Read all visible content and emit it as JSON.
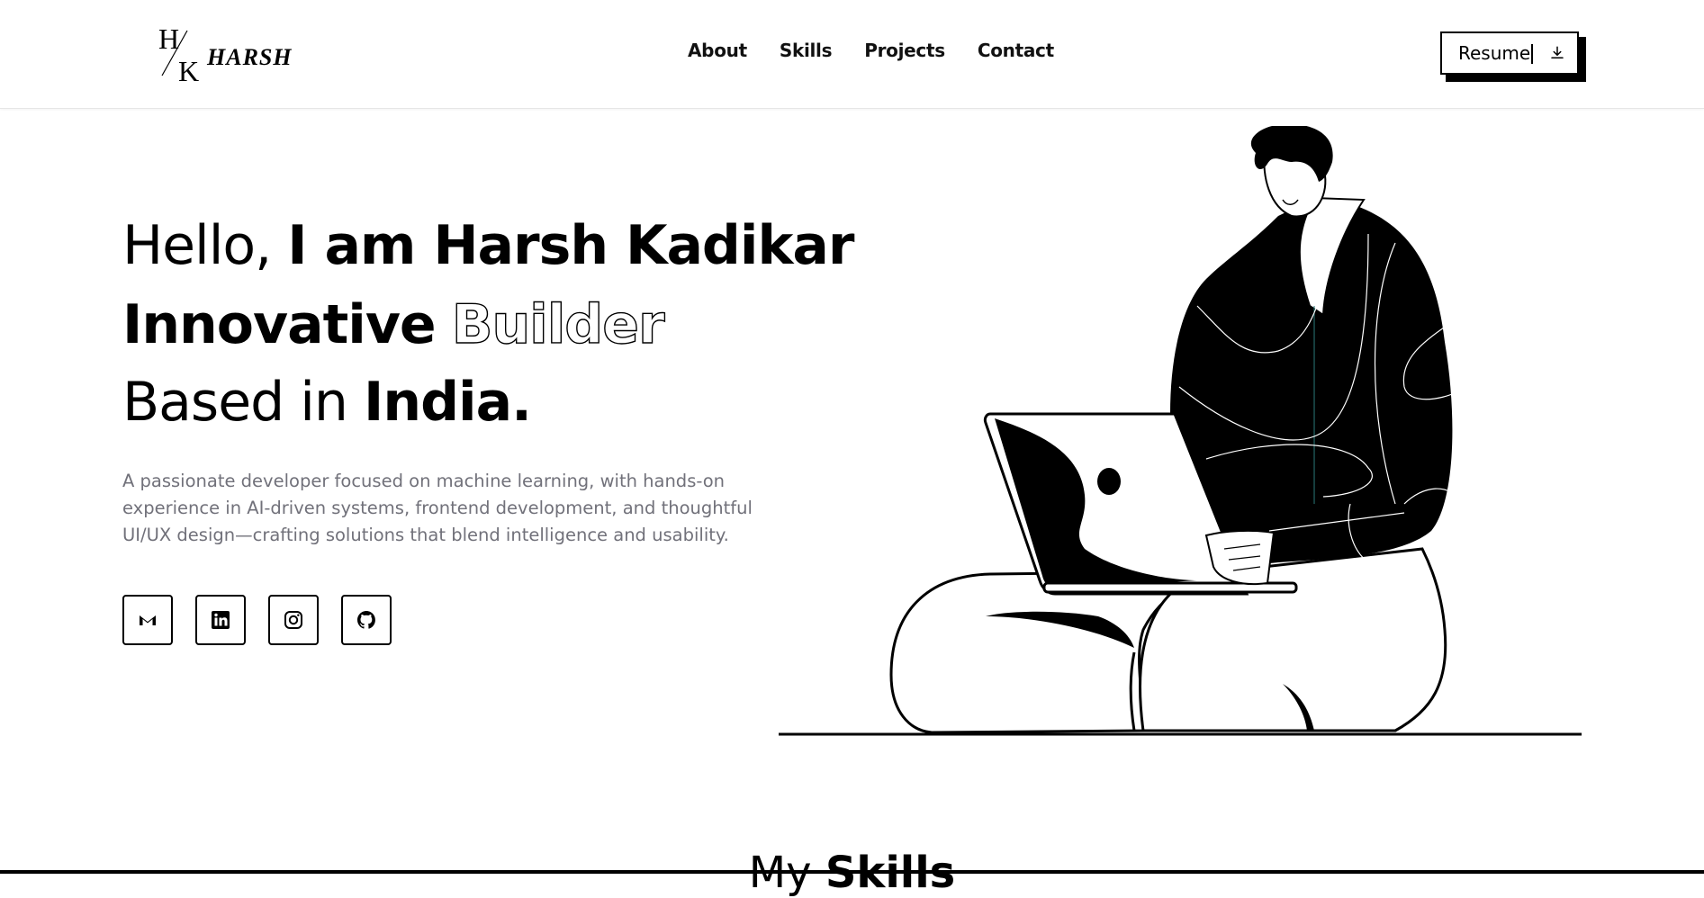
{
  "logo": {
    "alt": "HK Harsh logo",
    "letters": "HK",
    "wordmark": "HARSH"
  },
  "nav": {
    "items": [
      {
        "label": "About"
      },
      {
        "label": "Skills"
      },
      {
        "label": "Projects"
      },
      {
        "label": "Contact"
      }
    ]
  },
  "resume": {
    "label": "Resume",
    "icon": "download-icon"
  },
  "hero": {
    "line1_regular": "Hello,",
    "line1_bold": "I am Harsh Kadikar",
    "line2_bold": "Innovative",
    "line2_outline": "Builder",
    "line3_regular": "Based in",
    "line3_bold": "India.",
    "description": "A passionate developer focused on machine learning, with hands-on experience in AI-driven systems, frontend development, and thoughtful UI/UX design—crafting solutions that blend intelligence and usability."
  },
  "socials": [
    {
      "name": "gmail",
      "icon": "gmail-icon"
    },
    {
      "name": "linkedin",
      "icon": "linkedin-icon"
    },
    {
      "name": "instagram",
      "icon": "instagram-icon"
    },
    {
      "name": "github",
      "icon": "github-icon"
    }
  ],
  "skills_section": {
    "title_regular": "My",
    "title_bold": "Skills"
  },
  "colors": {
    "text": "#000000",
    "muted": "#71717a",
    "background": "#ffffff"
  }
}
